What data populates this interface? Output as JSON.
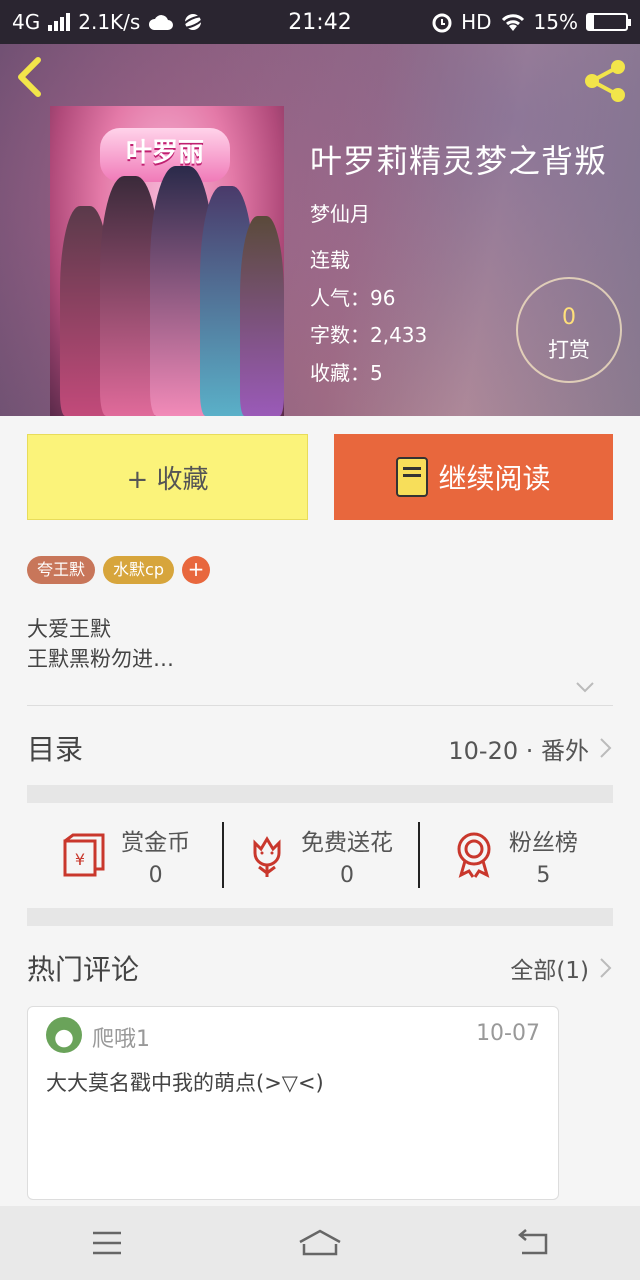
{
  "status_bar": {
    "network": "4G",
    "speed": "2.1K/s",
    "time": "21:42",
    "hd": "HD",
    "battery": "15%",
    "battery_level": 0.15
  },
  "book": {
    "title": "叶罗莉精灵梦之背叛",
    "author": "梦仙月",
    "status": "连载",
    "popularity": "人气：96",
    "word_count": "字数：2,433",
    "favorites": "收藏：5",
    "cover_logo": "叶罗丽",
    "reward": {
      "count": "0",
      "label": "打赏"
    }
  },
  "actions": {
    "favorite": "+ 收藏",
    "continue_reading": "继续阅读"
  },
  "tags": [
    {
      "label": "夸王默",
      "color": "#c8765a"
    },
    {
      "label": "水默cp",
      "color": "#d7a53c"
    }
  ],
  "tag_add": "+",
  "intro": {
    "line1": "大爱王默",
    "line2": "王默黑粉勿进…"
  },
  "toc": {
    "title": "目录",
    "latest": "10-20 · 番外"
  },
  "stats": [
    {
      "label": "赏金币",
      "value": "0",
      "icon": "red-envelope-icon"
    },
    {
      "label": "免费送花",
      "value": "0",
      "icon": "flower-icon"
    },
    {
      "label": "粉丝榜",
      "value": "5",
      "icon": "medal-icon"
    }
  ],
  "hot_comments": {
    "title": "热门评论",
    "all_label": "全部(1)",
    "comments": [
      {
        "user": "爬哦1",
        "date": "10-07",
        "text": "大大莫名戳中我的萌点(>▽<)"
      }
    ]
  },
  "colors": {
    "accent_orange": "#e8673d",
    "fav_yellow": "#fbf37a",
    "icon_red": "#c9372c",
    "header_yellow": "#f2e54a"
  }
}
